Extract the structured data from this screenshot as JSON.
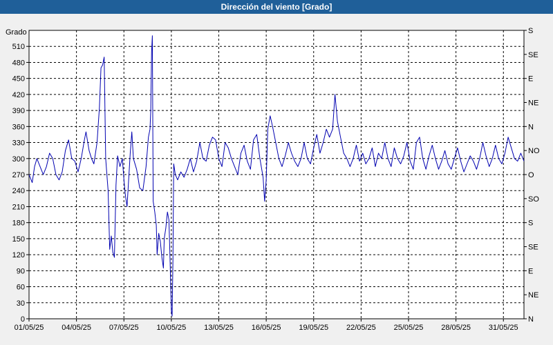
{
  "window": {
    "title": "Dirección del viento [Grado]"
  },
  "chart_data": {
    "type": "line",
    "title": "Dirección del viento [Grado]",
    "ylabel": "Grado",
    "ylim": [
      0,
      540
    ],
    "y_ticks": [
      0,
      30,
      60,
      90,
      120,
      150,
      180,
      210,
      240,
      270,
      300,
      330,
      360,
      390,
      420,
      450,
      480,
      510
    ],
    "y2_ticks": [
      {
        "value": 0,
        "label": "N"
      },
      {
        "value": 30,
        "label": "NE"
      },
      {
        "value": 60,
        "label": "E"
      },
      {
        "value": 90,
        "label": "SE"
      },
      {
        "value": 120,
        "label": "S"
      },
      {
        "value": 150,
        "label": "SO"
      },
      {
        "value": 180,
        "label": "O"
      },
      {
        "value": 210,
        "label": "NO"
      },
      {
        "value": 240,
        "label": "N"
      },
      {
        "value": 270,
        "label": "NE"
      },
      {
        "value": 300,
        "label": "E"
      },
      {
        "value": 330,
        "label": "SE"
      },
      {
        "value": 360,
        "label": "S"
      }
    ],
    "y2lim": [
      0,
      360
    ],
    "xlim": [
      0,
      31.3
    ],
    "x_ticks": [
      {
        "day": 0,
        "label": "01/05/25"
      },
      {
        "day": 3,
        "label": "04/05/25"
      },
      {
        "day": 6,
        "label": "07/05/25"
      },
      {
        "day": 9,
        "label": "10/05/25"
      },
      {
        "day": 12,
        "label": "13/05/25"
      },
      {
        "day": 15,
        "label": "16/05/25"
      },
      {
        "day": 18,
        "label": "19/05/25"
      },
      {
        "day": 21,
        "label": "22/05/25"
      },
      {
        "day": 24,
        "label": "25/05/25"
      },
      {
        "day": 27,
        "label": "28/05/25"
      },
      {
        "day": 30,
        "label": "31/05/25"
      }
    ],
    "grid": true,
    "series": [
      {
        "color": "#0000b0",
        "points": [
          [
            0.0,
            270
          ],
          [
            0.2,
            255
          ],
          [
            0.35,
            285
          ],
          [
            0.5,
            300
          ],
          [
            0.7,
            285
          ],
          [
            0.9,
            270
          ],
          [
            1.1,
            285
          ],
          [
            1.3,
            310
          ],
          [
            1.5,
            300
          ],
          [
            1.7,
            270
          ],
          [
            1.9,
            260
          ],
          [
            2.1,
            275
          ],
          [
            2.3,
            315
          ],
          [
            2.5,
            335
          ],
          [
            2.7,
            300
          ],
          [
            2.9,
            295
          ],
          [
            3.1,
            275
          ],
          [
            3.3,
            300
          ],
          [
            3.5,
            335
          ],
          [
            3.6,
            350
          ],
          [
            3.8,
            315
          ],
          [
            3.95,
            300
          ],
          [
            4.1,
            290
          ],
          [
            4.3,
            330
          ],
          [
            4.45,
            395
          ],
          [
            4.55,
            470
          ],
          [
            4.65,
            475
          ],
          [
            4.75,
            490
          ],
          [
            4.85,
            300
          ],
          [
            4.95,
            260
          ],
          [
            5.0,
            240
          ],
          [
            5.1,
            130
          ],
          [
            5.2,
            155
          ],
          [
            5.3,
            125
          ],
          [
            5.4,
            115
          ],
          [
            5.5,
            250
          ],
          [
            5.6,
            305
          ],
          [
            5.75,
            285
          ],
          [
            5.9,
            300
          ],
          [
            6.0,
            260
          ],
          [
            6.1,
            230
          ],
          [
            6.2,
            210
          ],
          [
            6.3,
            260
          ],
          [
            6.4,
            310
          ],
          [
            6.5,
            350
          ],
          [
            6.6,
            300
          ],
          [
            6.8,
            280
          ],
          [
            7.0,
            245
          ],
          [
            7.2,
            240
          ],
          [
            7.4,
            285
          ],
          [
            7.55,
            340
          ],
          [
            7.65,
            355
          ],
          [
            7.7,
            390
          ],
          [
            7.75,
            500
          ],
          [
            7.8,
            530
          ],
          [
            7.85,
            220
          ],
          [
            7.95,
            200
          ],
          [
            8.05,
            175
          ],
          [
            8.1,
            120
          ],
          [
            8.2,
            160
          ],
          [
            8.3,
            145
          ],
          [
            8.4,
            115
          ],
          [
            8.5,
            95
          ],
          [
            8.55,
            150
          ],
          [
            8.65,
            170
          ],
          [
            8.75,
            200
          ],
          [
            8.85,
            185
          ],
          [
            8.9,
            130
          ],
          [
            9.0,
            15
          ],
          [
            9.05,
            5
          ],
          [
            9.1,
            110
          ],
          [
            9.15,
            290
          ],
          [
            9.25,
            270
          ],
          [
            9.4,
            260
          ],
          [
            9.6,
            275
          ],
          [
            9.8,
            265
          ],
          [
            10.0,
            280
          ],
          [
            10.2,
            300
          ],
          [
            10.4,
            275
          ],
          [
            10.6,
            295
          ],
          [
            10.8,
            330
          ],
          [
            11.0,
            300
          ],
          [
            11.2,
            295
          ],
          [
            11.4,
            325
          ],
          [
            11.6,
            340
          ],
          [
            11.8,
            335
          ],
          [
            12.0,
            300
          ],
          [
            12.2,
            285
          ],
          [
            12.4,
            330
          ],
          [
            12.6,
            320
          ],
          [
            12.8,
            300
          ],
          [
            13.0,
            285
          ],
          [
            13.2,
            270
          ],
          [
            13.4,
            310
          ],
          [
            13.6,
            325
          ],
          [
            13.8,
            295
          ],
          [
            14.0,
            280
          ],
          [
            14.2,
            335
          ],
          [
            14.4,
            345
          ],
          [
            14.6,
            300
          ],
          [
            14.8,
            265
          ],
          [
            14.9,
            220
          ],
          [
            15.0,
            260
          ],
          [
            15.1,
            355
          ],
          [
            15.25,
            380
          ],
          [
            15.4,
            360
          ],
          [
            15.6,
            330
          ],
          [
            15.8,
            300
          ],
          [
            16.0,
            285
          ],
          [
            16.2,
            305
          ],
          [
            16.4,
            330
          ],
          [
            16.6,
            310
          ],
          [
            16.8,
            295
          ],
          [
            17.0,
            285
          ],
          [
            17.2,
            300
          ],
          [
            17.4,
            330
          ],
          [
            17.6,
            300
          ],
          [
            17.8,
            290
          ],
          [
            18.0,
            320
          ],
          [
            18.2,
            345
          ],
          [
            18.4,
            310
          ],
          [
            18.6,
            330
          ],
          [
            18.8,
            355
          ],
          [
            19.0,
            340
          ],
          [
            19.2,
            355
          ],
          [
            19.35,
            420
          ],
          [
            19.5,
            370
          ],
          [
            19.7,
            340
          ],
          [
            19.9,
            310
          ],
          [
            20.1,
            300
          ],
          [
            20.3,
            285
          ],
          [
            20.5,
            300
          ],
          [
            20.7,
            325
          ],
          [
            20.9,
            295
          ],
          [
            21.1,
            310
          ],
          [
            21.3,
            290
          ],
          [
            21.5,
            300
          ],
          [
            21.7,
            320
          ],
          [
            21.9,
            285
          ],
          [
            22.1,
            310
          ],
          [
            22.3,
            300
          ],
          [
            22.5,
            330
          ],
          [
            22.7,
            300
          ],
          [
            22.9,
            285
          ],
          [
            23.1,
            320
          ],
          [
            23.3,
            300
          ],
          [
            23.5,
            290
          ],
          [
            23.7,
            305
          ],
          [
            23.9,
            330
          ],
          [
            24.1,
            295
          ],
          [
            24.3,
            280
          ],
          [
            24.5,
            330
          ],
          [
            24.7,
            340
          ],
          [
            24.9,
            300
          ],
          [
            25.1,
            280
          ],
          [
            25.3,
            305
          ],
          [
            25.5,
            325
          ],
          [
            25.7,
            300
          ],
          [
            25.9,
            280
          ],
          [
            26.1,
            295
          ],
          [
            26.3,
            315
          ],
          [
            26.5,
            290
          ],
          [
            26.7,
            280
          ],
          [
            26.9,
            300
          ],
          [
            27.1,
            320
          ],
          [
            27.3,
            295
          ],
          [
            27.5,
            275
          ],
          [
            27.7,
            290
          ],
          [
            27.9,
            305
          ],
          [
            28.1,
            295
          ],
          [
            28.3,
            280
          ],
          [
            28.5,
            300
          ],
          [
            28.7,
            330
          ],
          [
            28.9,
            305
          ],
          [
            29.1,
            285
          ],
          [
            29.3,
            300
          ],
          [
            29.5,
            325
          ],
          [
            29.7,
            300
          ],
          [
            29.9,
            290
          ],
          [
            30.1,
            310
          ],
          [
            30.3,
            340
          ],
          [
            30.5,
            320
          ],
          [
            30.7,
            300
          ],
          [
            30.9,
            295
          ],
          [
            31.1,
            310
          ],
          [
            31.3,
            295
          ]
        ]
      }
    ],
    "colors": {
      "title_bar": "#1f5f99",
      "title_text": "#ffffff",
      "plot_background": "#ffffff",
      "frame_background": "#f0f0f0",
      "line": "#0000b0",
      "grid": "#000000"
    }
  }
}
